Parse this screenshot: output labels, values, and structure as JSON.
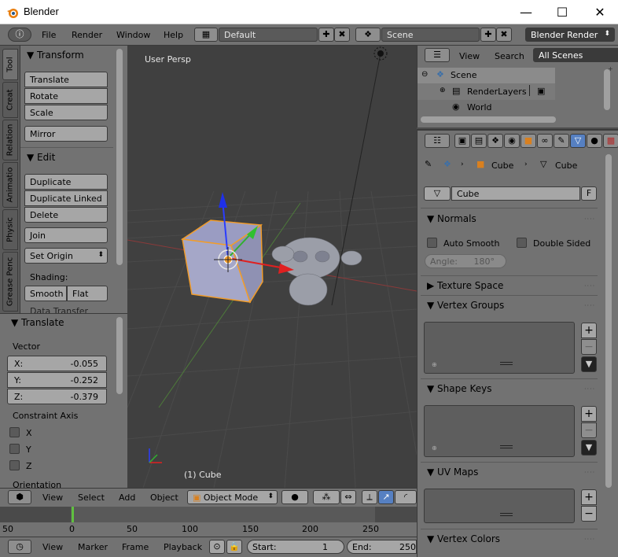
{
  "window": {
    "title": "Blender",
    "min": "—",
    "max": "☐",
    "close": "✕"
  },
  "topbar": {
    "menus": [
      "File",
      "Render",
      "Window",
      "Help"
    ],
    "layout": "Default",
    "scene": "Scene",
    "engine": "Blender Render"
  },
  "tabs": [
    "Tool",
    "Creat",
    "Relation",
    "Animatio",
    "Physic",
    "Grease Penc"
  ],
  "toolpanel": {
    "transform_header": "Transform",
    "transform_buttons": [
      "Translate",
      "Rotate",
      "Scale"
    ],
    "mirror": "Mirror",
    "edit_header": "Edit",
    "edit_buttons": [
      "Duplicate",
      "Duplicate Linked",
      "Delete"
    ],
    "join": "Join",
    "set_origin": "Set Origin",
    "shading_label": "Shading:",
    "smooth": "Smooth",
    "flat": "Flat",
    "cut": "Data Transfer"
  },
  "redo": {
    "header": "Translate",
    "vector_label": "Vector",
    "x": {
      "label": "X:",
      "value": "-0.055"
    },
    "y": {
      "label": "Y:",
      "value": "-0.252"
    },
    "z": {
      "label": "Z:",
      "value": "-0.379"
    },
    "constraint_label": "Constraint Axis",
    "axes": [
      "X",
      "Y",
      "Z"
    ],
    "orientation": "Orientation"
  },
  "viewport": {
    "view_label": "User Persp",
    "object_label": "(1) Cube"
  },
  "v3dheader": {
    "menus": [
      "View",
      "Select",
      "Add",
      "Object"
    ],
    "mode": "Object Mode"
  },
  "timeline": {
    "ticks": [
      "50",
      "0",
      "50",
      "100",
      "150",
      "200",
      "250"
    ],
    "current_frame": 0
  },
  "tlheader": {
    "menus": [
      "View",
      "Marker",
      "Frame",
      "Playback"
    ],
    "start_label": "Start:",
    "start_value": "1",
    "end_label": "End:",
    "end_value": "250"
  },
  "outliner": {
    "menus": [
      "View",
      "Search"
    ],
    "filter": "All Scenes",
    "items": [
      "Scene",
      "RenderLayers",
      "World"
    ]
  },
  "props": {
    "breadcrumb_obj": "Cube",
    "breadcrumb_mesh": "Cube",
    "mesh_name": "Cube",
    "fake_user": "F",
    "normals_header": "Normals",
    "auto_smooth": "Auto Smooth",
    "double_sided": "Double Sided",
    "angle": "Angle:",
    "angle_value": "180°",
    "texture_space": "Texture Space",
    "vertex_groups": "Vertex Groups",
    "shape_keys": "Shape Keys",
    "uv_maps": "UV Maps",
    "vertex_colors": "Vertex Colors"
  },
  "colors": {
    "accent": "#5680c2",
    "selected_outline": "#f19c2a",
    "frame_marker": "#60c040"
  }
}
